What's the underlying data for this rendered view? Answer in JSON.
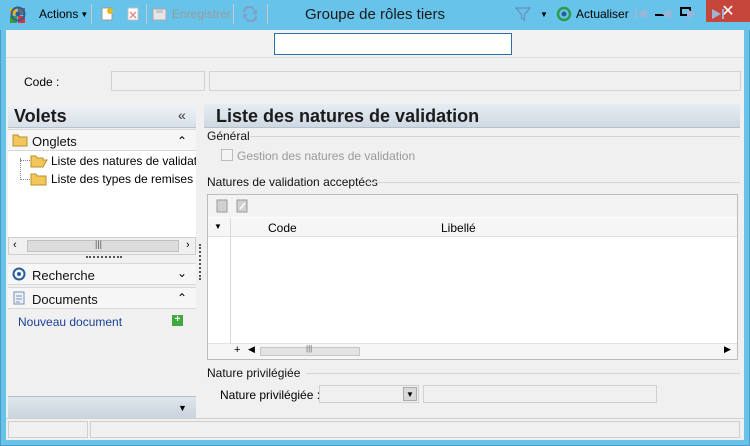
{
  "window": {
    "title": "Groupe de rôles tiers"
  },
  "toolbar": {
    "actions_label": "Actions",
    "save_label": "Enregistrer",
    "search_value": "",
    "refresh_label": "Actualiser"
  },
  "code_row": {
    "label": "Code :",
    "value": ""
  },
  "left_panel": {
    "title": "Volets",
    "onglets_label": "Onglets",
    "tree_items": [
      "Liste des natures de validation",
      "Liste des types de remises"
    ],
    "recherche_label": "Recherche",
    "documents_label": "Documents",
    "new_document_label": "Nouveau document"
  },
  "main": {
    "title": "Liste des natures de validation",
    "general_title": "Général",
    "checkbox_label": "Gestion des natures de validation",
    "checkbox_checked": false,
    "accepted_title": "Natures de validation acceptées",
    "grid_columns": [
      "Code",
      "Libellé"
    ],
    "privileged_title": "Nature privilégiée",
    "privileged_label": "Nature privilégiée :",
    "privileged_value": ""
  },
  "colors": {
    "titlebar": "#68c3ea",
    "close_button": "#c7463c",
    "link": "#1b3f97"
  }
}
